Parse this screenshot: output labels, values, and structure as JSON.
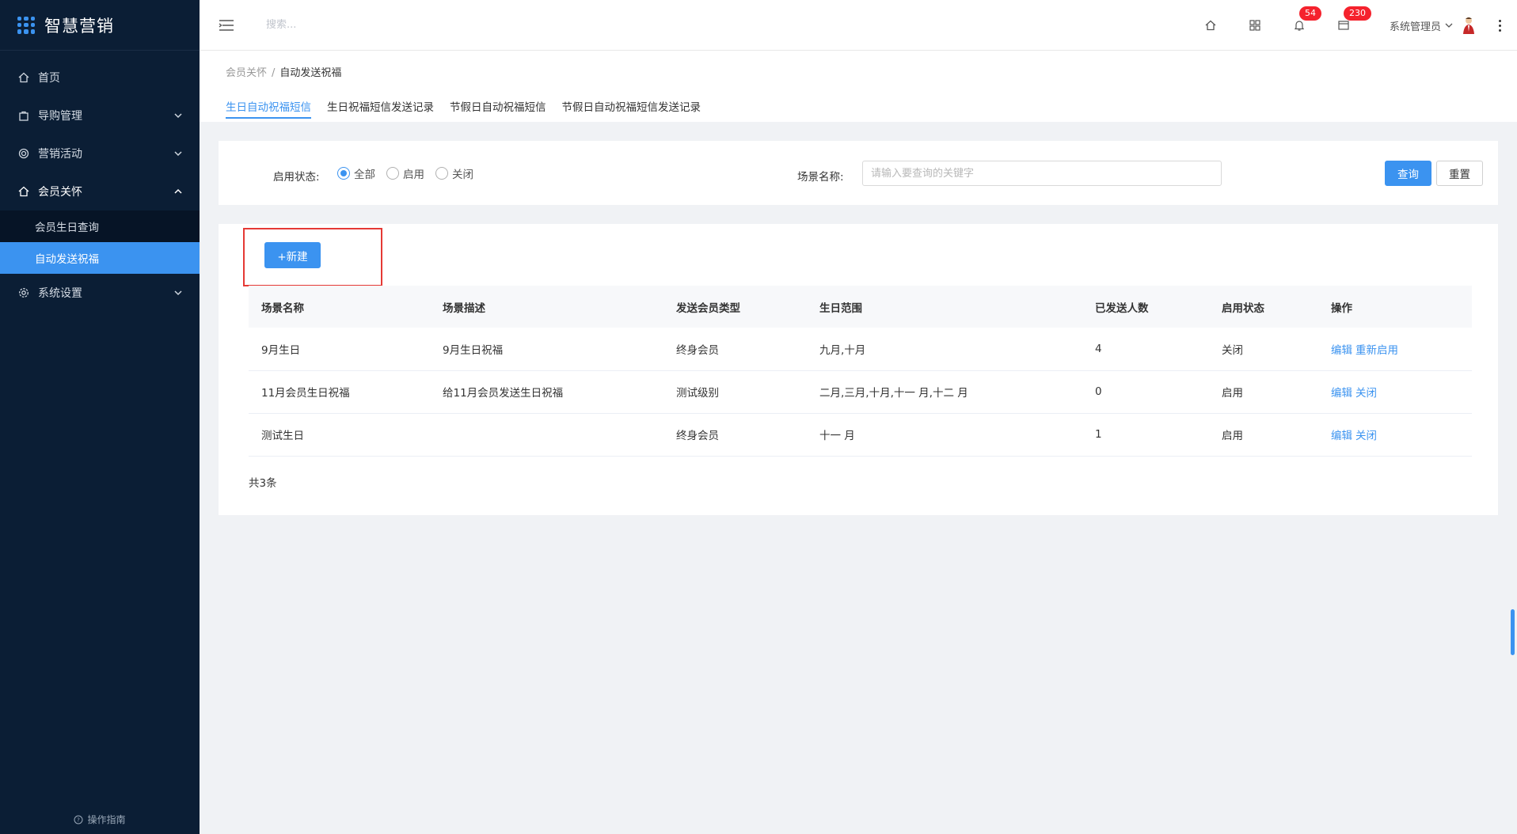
{
  "app": {
    "title": "智慧营销"
  },
  "sidebar": {
    "items": [
      {
        "label": "首页",
        "icon": "home-icon"
      },
      {
        "label": "导购管理",
        "icon": "bag-icon"
      },
      {
        "label": "营销活动",
        "icon": "target-icon"
      },
      {
        "label": "会员关怀",
        "icon": "home-icon"
      },
      {
        "label": "系统设置",
        "icon": "gear-icon"
      }
    ],
    "submenu": [
      {
        "label": "会员生日查询"
      },
      {
        "label": "自动发送祝福"
      }
    ],
    "guide": "操作指南"
  },
  "header": {
    "search_placeholder": "搜索...",
    "badge_bell": "54",
    "badge_mail": "230",
    "user": "系统管理员"
  },
  "breadcrumb": {
    "parent": "会员关怀",
    "sep": "/",
    "current": "自动发送祝福"
  },
  "tabs": [
    {
      "label": "生日自动祝福短信"
    },
    {
      "label": "生日祝福短信发送记录"
    },
    {
      "label": "节假日自动祝福短信"
    },
    {
      "label": "节假日自动祝福短信发送记录"
    }
  ],
  "filter": {
    "status_label": "启用状态:",
    "options": [
      "全部",
      "启用",
      "关闭"
    ],
    "selected": "全部",
    "scene_label": "场景名称:",
    "scene_placeholder": "请输入要查询的关键字",
    "query_label": "查询",
    "reset_label": "重置"
  },
  "table": {
    "new_label": "+新建",
    "columns": [
      "场景名称",
      "场景描述",
      "发送会员类型",
      "生日范围",
      "已发送人数",
      "启用状态",
      "操作"
    ],
    "rows": [
      {
        "name": "9月生日",
        "desc": "9月生日祝福",
        "type": "终身会员",
        "range": "九月,十月",
        "sent": "4",
        "status": "关闭",
        "op1": "编辑",
        "op2": "重新启用"
      },
      {
        "name": "11月会员生日祝福",
        "desc": "给11月会员发送生日祝福",
        "type": "测试级别",
        "range": "二月,三月,十月,十一 月,十二 月",
        "sent": "0",
        "status": "启用",
        "op1": "编辑",
        "op2": "关闭"
      },
      {
        "name": "测试生日",
        "desc": "",
        "type": "终身会员",
        "range": "十一 月",
        "sent": "1",
        "status": "启用",
        "op1": "编辑",
        "op2": "关闭"
      }
    ],
    "total": "共3条"
  },
  "colors": {
    "primary": "#3b93f0",
    "sidebar_bg": "#0b1e35",
    "badge": "#f5222d",
    "highlight": "#e53935"
  }
}
